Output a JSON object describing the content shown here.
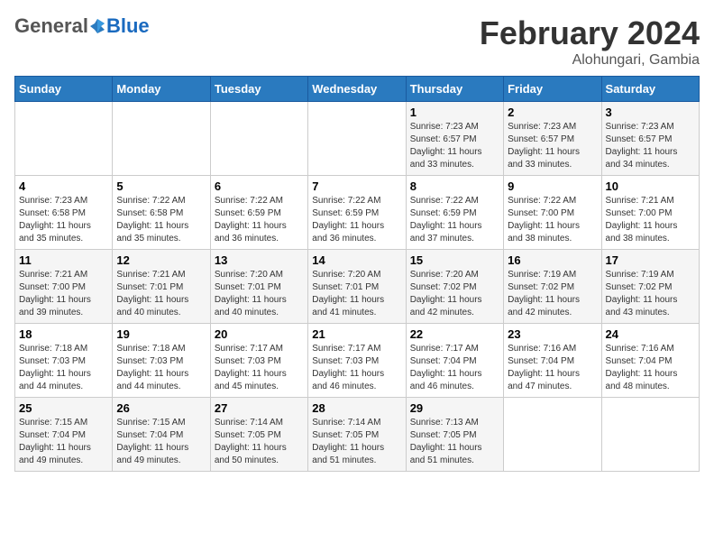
{
  "header": {
    "logo_general": "General",
    "logo_blue": "Blue",
    "month_title": "February 2024",
    "location": "Alohungari, Gambia"
  },
  "days_of_week": [
    "Sunday",
    "Monday",
    "Tuesday",
    "Wednesday",
    "Thursday",
    "Friday",
    "Saturday"
  ],
  "weeks": [
    [
      {
        "day": "",
        "info": ""
      },
      {
        "day": "",
        "info": ""
      },
      {
        "day": "",
        "info": ""
      },
      {
        "day": "",
        "info": ""
      },
      {
        "day": "1",
        "info": "Sunrise: 7:23 AM\nSunset: 6:57 PM\nDaylight: 11 hours\nand 33 minutes."
      },
      {
        "day": "2",
        "info": "Sunrise: 7:23 AM\nSunset: 6:57 PM\nDaylight: 11 hours\nand 33 minutes."
      },
      {
        "day": "3",
        "info": "Sunrise: 7:23 AM\nSunset: 6:57 PM\nDaylight: 11 hours\nand 34 minutes."
      }
    ],
    [
      {
        "day": "4",
        "info": "Sunrise: 7:23 AM\nSunset: 6:58 PM\nDaylight: 11 hours\nand 35 minutes."
      },
      {
        "day": "5",
        "info": "Sunrise: 7:22 AM\nSunset: 6:58 PM\nDaylight: 11 hours\nand 35 minutes."
      },
      {
        "day": "6",
        "info": "Sunrise: 7:22 AM\nSunset: 6:59 PM\nDaylight: 11 hours\nand 36 minutes."
      },
      {
        "day": "7",
        "info": "Sunrise: 7:22 AM\nSunset: 6:59 PM\nDaylight: 11 hours\nand 36 minutes."
      },
      {
        "day": "8",
        "info": "Sunrise: 7:22 AM\nSunset: 6:59 PM\nDaylight: 11 hours\nand 37 minutes."
      },
      {
        "day": "9",
        "info": "Sunrise: 7:22 AM\nSunset: 7:00 PM\nDaylight: 11 hours\nand 38 minutes."
      },
      {
        "day": "10",
        "info": "Sunrise: 7:21 AM\nSunset: 7:00 PM\nDaylight: 11 hours\nand 38 minutes."
      }
    ],
    [
      {
        "day": "11",
        "info": "Sunrise: 7:21 AM\nSunset: 7:00 PM\nDaylight: 11 hours\nand 39 minutes."
      },
      {
        "day": "12",
        "info": "Sunrise: 7:21 AM\nSunset: 7:01 PM\nDaylight: 11 hours\nand 40 minutes."
      },
      {
        "day": "13",
        "info": "Sunrise: 7:20 AM\nSunset: 7:01 PM\nDaylight: 11 hours\nand 40 minutes."
      },
      {
        "day": "14",
        "info": "Sunrise: 7:20 AM\nSunset: 7:01 PM\nDaylight: 11 hours\nand 41 minutes."
      },
      {
        "day": "15",
        "info": "Sunrise: 7:20 AM\nSunset: 7:02 PM\nDaylight: 11 hours\nand 42 minutes."
      },
      {
        "day": "16",
        "info": "Sunrise: 7:19 AM\nSunset: 7:02 PM\nDaylight: 11 hours\nand 42 minutes."
      },
      {
        "day": "17",
        "info": "Sunrise: 7:19 AM\nSunset: 7:02 PM\nDaylight: 11 hours\nand 43 minutes."
      }
    ],
    [
      {
        "day": "18",
        "info": "Sunrise: 7:18 AM\nSunset: 7:03 PM\nDaylight: 11 hours\nand 44 minutes."
      },
      {
        "day": "19",
        "info": "Sunrise: 7:18 AM\nSunset: 7:03 PM\nDaylight: 11 hours\nand 44 minutes."
      },
      {
        "day": "20",
        "info": "Sunrise: 7:17 AM\nSunset: 7:03 PM\nDaylight: 11 hours\nand 45 minutes."
      },
      {
        "day": "21",
        "info": "Sunrise: 7:17 AM\nSunset: 7:03 PM\nDaylight: 11 hours\nand 46 minutes."
      },
      {
        "day": "22",
        "info": "Sunrise: 7:17 AM\nSunset: 7:04 PM\nDaylight: 11 hours\nand 46 minutes."
      },
      {
        "day": "23",
        "info": "Sunrise: 7:16 AM\nSunset: 7:04 PM\nDaylight: 11 hours\nand 47 minutes."
      },
      {
        "day": "24",
        "info": "Sunrise: 7:16 AM\nSunset: 7:04 PM\nDaylight: 11 hours\nand 48 minutes."
      }
    ],
    [
      {
        "day": "25",
        "info": "Sunrise: 7:15 AM\nSunset: 7:04 PM\nDaylight: 11 hours\nand 49 minutes."
      },
      {
        "day": "26",
        "info": "Sunrise: 7:15 AM\nSunset: 7:04 PM\nDaylight: 11 hours\nand 49 minutes."
      },
      {
        "day": "27",
        "info": "Sunrise: 7:14 AM\nSunset: 7:05 PM\nDaylight: 11 hours\nand 50 minutes."
      },
      {
        "day": "28",
        "info": "Sunrise: 7:14 AM\nSunset: 7:05 PM\nDaylight: 11 hours\nand 51 minutes."
      },
      {
        "day": "29",
        "info": "Sunrise: 7:13 AM\nSunset: 7:05 PM\nDaylight: 11 hours\nand 51 minutes."
      },
      {
        "day": "",
        "info": ""
      },
      {
        "day": "",
        "info": ""
      }
    ]
  ]
}
